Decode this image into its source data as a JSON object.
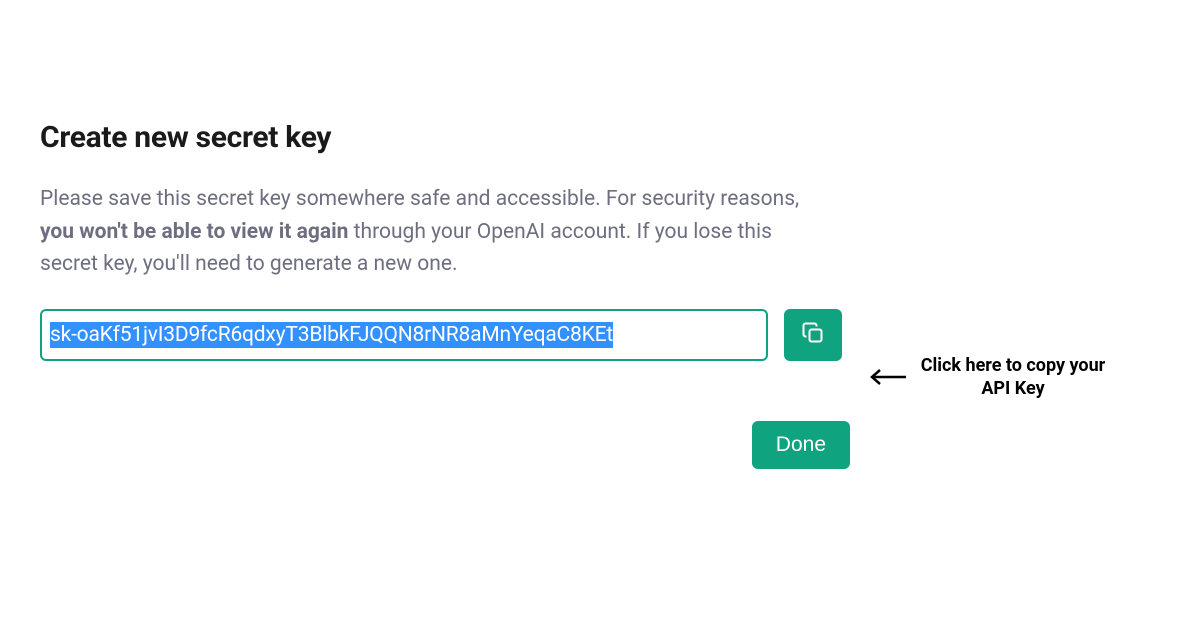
{
  "modal": {
    "title": "Create new secret key",
    "description_part1": "Please save this secret key somewhere safe and accessible. For security reasons, ",
    "description_bold": "you won't be able to view it again",
    "description_part2": " through your OpenAI account. If you lose this secret key, you'll need to generate a new one.",
    "secret_key_value": "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",
    "done_label": "Done"
  },
  "annotation": {
    "text": "Click here to copy your API Key"
  }
}
